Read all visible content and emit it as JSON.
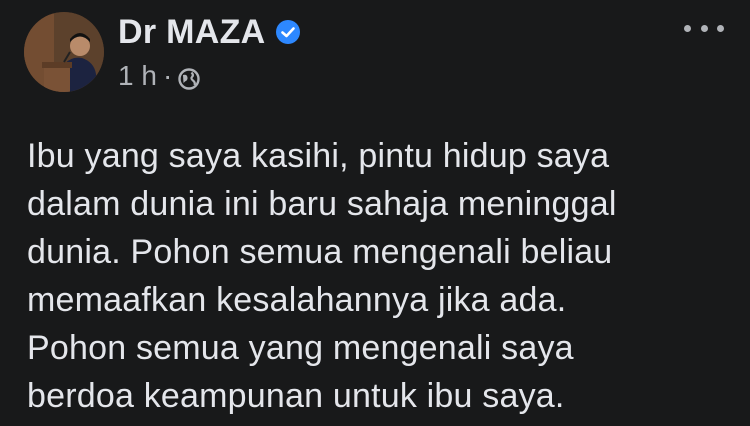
{
  "post": {
    "author": {
      "name": "Dr MAZA",
      "verified": true,
      "avatar_icon": "profile-photo-man-at-lectern"
    },
    "meta": {
      "time": "1 h",
      "separator": "·",
      "audience_icon": "globe-icon"
    },
    "more_icon": "more-options-icon",
    "body_lines": [
      "Ibu yang saya kasihi, pintu hidup saya",
      "dalam dunia ini baru sahaja meninggal",
      "dunia. Pohon semua mengenali beliau",
      "memaafkan kesalahannya jika ada.",
      "Pohon semua yang mengenali saya",
      "berdoa keampunan untuk ibu saya."
    ]
  },
  "colors": {
    "background": "#18191a",
    "primary_text": "#e4e6eb",
    "secondary_text": "#b0b3b8",
    "verified_badge": "#2d88ff"
  }
}
